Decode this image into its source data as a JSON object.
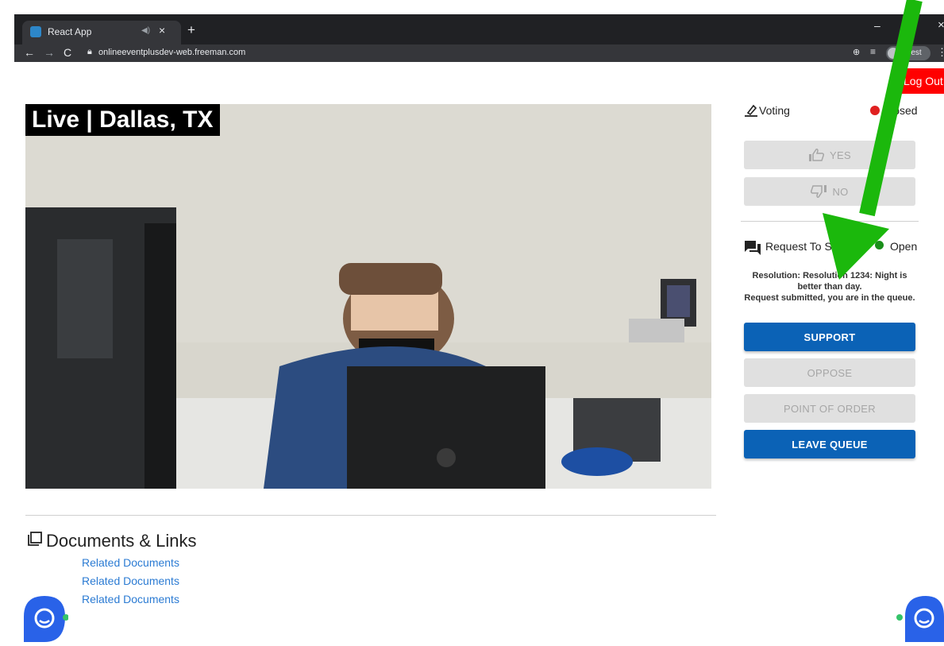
{
  "browser": {
    "tab_title": "React App",
    "tab_close": "×",
    "new_tab": "+",
    "url": "onlineeventplusdev-web.freeman.com",
    "profile": "Guest",
    "minimize": "–",
    "close": "×",
    "back": "←",
    "forward": "→",
    "reload": "C",
    "menu": "⋮"
  },
  "header": {
    "logout_label": "Log Out"
  },
  "video": {
    "overlay_label": "Live | Dallas, TX"
  },
  "voting": {
    "title": "Voting",
    "status": "Closed",
    "status_color": "#e02020",
    "yes_label": "YES",
    "no_label": "NO"
  },
  "request_to_speak": {
    "title": "Request To Speak",
    "status": "Open",
    "status_color": "#1a8f1a",
    "resolution_text": "Resolution: Resolution 1234: Night is better than day.",
    "queue_text": "Request submitted, you are in the queue.",
    "buttons": {
      "support": "SUPPORT",
      "oppose": "OPPOSE",
      "point_of_order": "POINT OF ORDER",
      "leave_queue": "LEAVE QUEUE"
    }
  },
  "documents": {
    "title": "Documents & Links",
    "links": [
      "Related Documents",
      "Related Documents",
      "Related Documents"
    ]
  },
  "colors": {
    "primary": "#0b62b6",
    "logout": "#ff0000",
    "annotation_arrow": "#1bb80c",
    "link": "#2b7bd3"
  },
  "icons": {
    "voting": "ballot-pencil-icon",
    "request_to_speak": "chat-bubbles-icon",
    "documents": "copy-stack-icon",
    "yes": "thumbs-up-icon",
    "no": "thumbs-down-icon",
    "chat": "chat-bubble-icon"
  }
}
